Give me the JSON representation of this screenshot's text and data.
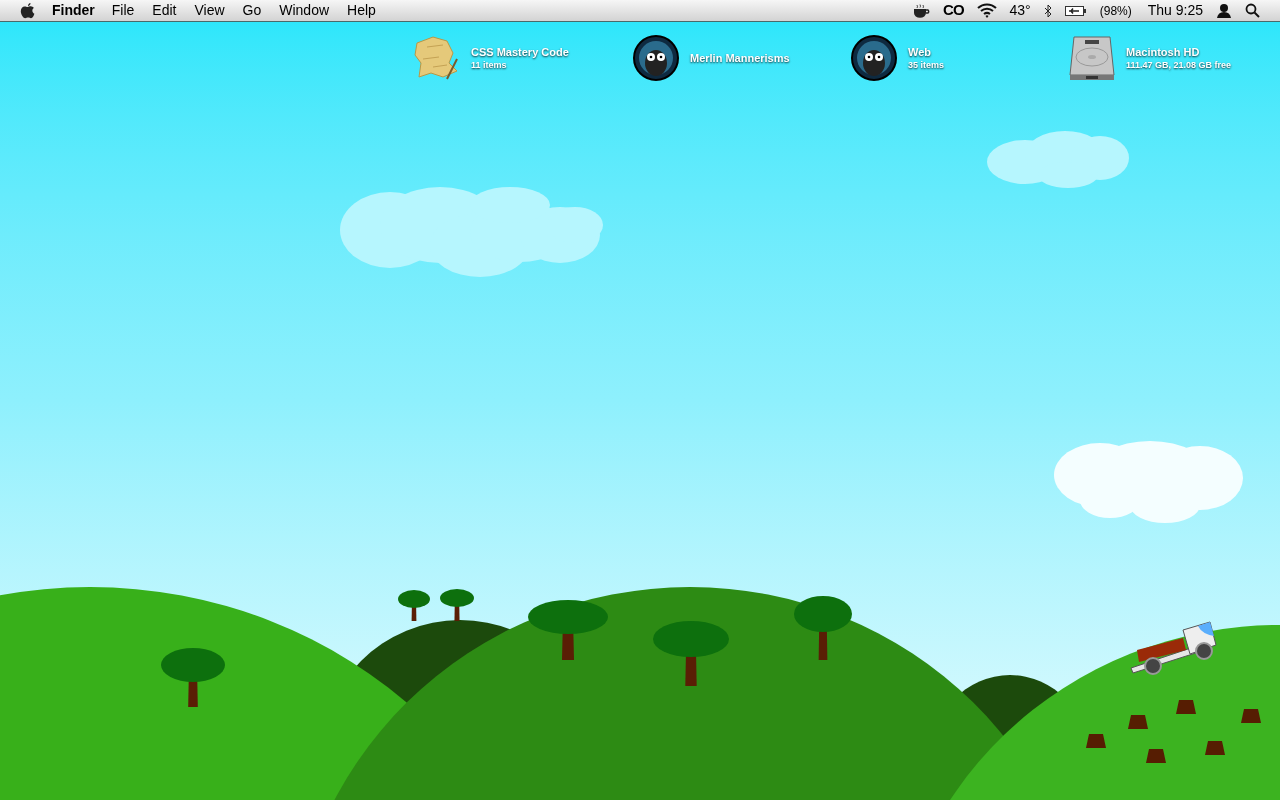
{
  "menu_bar": {
    "app_name": "Finder",
    "menus": [
      "File",
      "Edit",
      "View",
      "Go",
      "Window",
      "Help"
    ],
    "status_items": [
      {
        "kind": "cup"
      },
      {
        "kind": "text",
        "text": "CO"
      },
      {
        "kind": "wifi"
      },
      {
        "kind": "text",
        "text": "43°"
      },
      {
        "kind": "bluetooth"
      },
      {
        "kind": "battery"
      },
      {
        "kind": "text",
        "text": "(98%)"
      },
      {
        "kind": "clock",
        "text": "Thu 9:25"
      },
      {
        "kind": "user"
      },
      {
        "kind": "search"
      }
    ]
  },
  "desktop_items": [
    {
      "kind": "folder",
      "name": "CSS Mastery Code",
      "info": "11 items"
    },
    {
      "kind": "avatar",
      "name": "Merlin Mannerisms"
    },
    {
      "kind": "avatar",
      "name": "Web",
      "info": "35 items"
    },
    {
      "kind": "disk",
      "name": "Macintosh HD",
      "info": "111.47 GB, 21.08 GB free"
    }
  ]
}
